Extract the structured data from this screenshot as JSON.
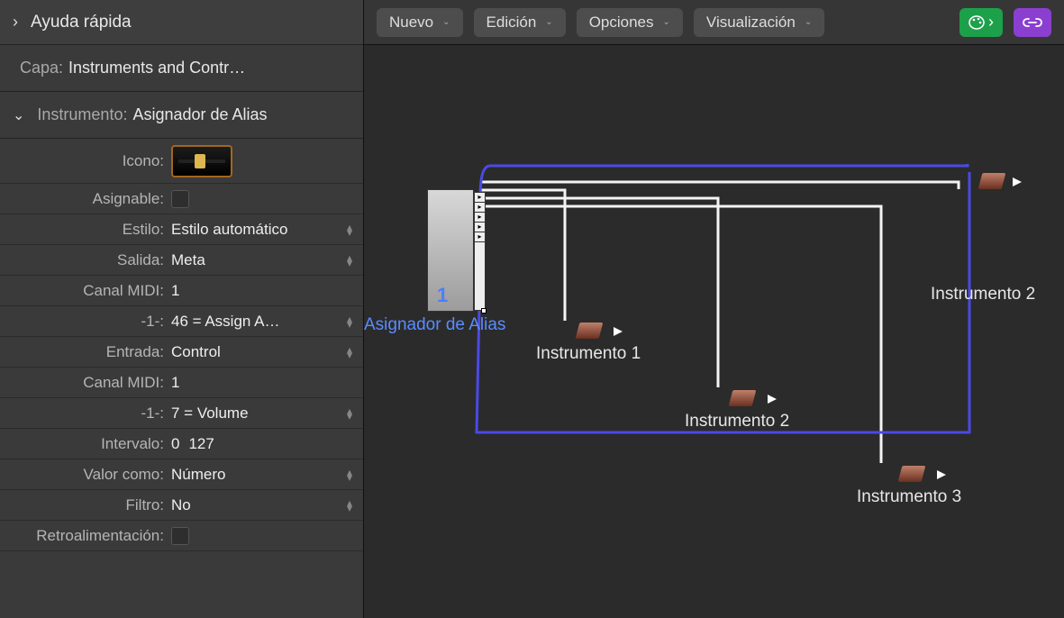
{
  "inspector": {
    "help_title": "Ayuda rápida",
    "layer_label": "Capa:",
    "layer_value": "Instruments and Contr…",
    "section_label": "Instrumento:",
    "section_value": "Asignador de Alias",
    "props": {
      "icono_label": "Icono:",
      "asignable_label": "Asignable:",
      "estilo_label": "Estilo:",
      "estilo_value": "Estilo automático",
      "salida_label": "Salida:",
      "salida_value": "Meta",
      "canal_midi1_label": "Canal MIDI:",
      "canal_midi1_value": "1",
      "neg1a_label": "-1-:",
      "neg1a_value": "46 = Assign A…",
      "entrada_label": "Entrada:",
      "entrada_value": "Control",
      "canal_midi2_label": "Canal MIDI:",
      "canal_midi2_value": "1",
      "neg1b_label": "-1-:",
      "neg1b_value": "7 = Volume",
      "intervalo_label": "Intervalo:",
      "intervalo_min": "0",
      "intervalo_max": "127",
      "valor_como_label": "Valor como:",
      "valor_como_value": "Número",
      "filtro_label": "Filtro:",
      "filtro_value": "No",
      "retro_label": "Retroalimentación:"
    }
  },
  "toolbar": {
    "nuevo": "Nuevo",
    "edicion": "Edición",
    "opciones": "Opciones",
    "visualizacion": "Visualización"
  },
  "canvas": {
    "alias_name": "Asignador de Alias",
    "alias_index": "1",
    "instr1": "Instrumento 1",
    "instr2": "Instrumento 2",
    "instr2_right": "Instrumento 2",
    "instr3": "Instrumento 3"
  }
}
